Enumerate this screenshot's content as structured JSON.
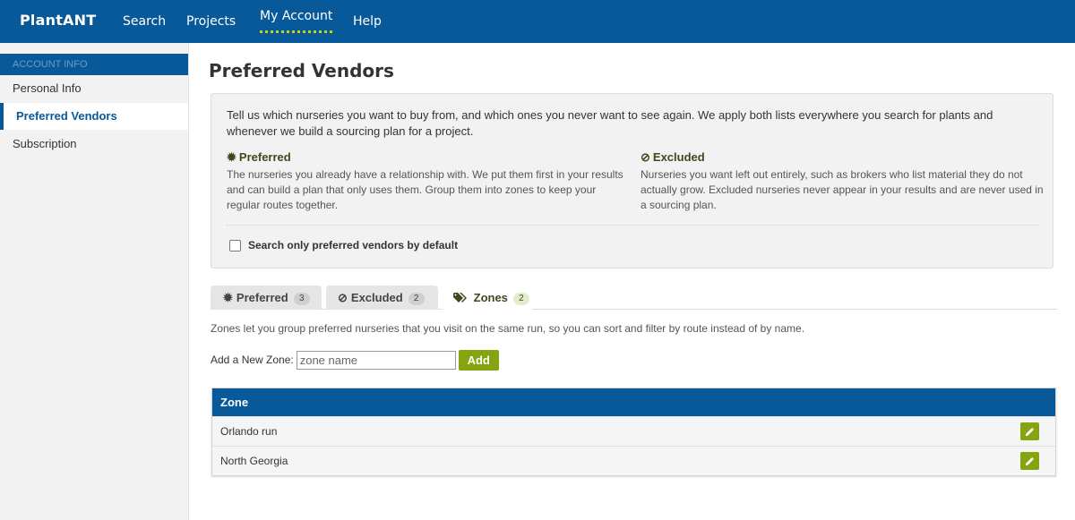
{
  "app": {
    "brand": "PlantANT",
    "nav": [
      {
        "label": "Search"
      },
      {
        "label": "Projects"
      },
      {
        "label": "My Account"
      },
      {
        "label": "Help"
      }
    ],
    "active_nav": "My Account"
  },
  "sidebar": {
    "heading": "ACCOUNT INFO",
    "items": [
      {
        "label": "Personal Info"
      },
      {
        "label": "Preferred Vendors"
      },
      {
        "label": "Subscription"
      }
    ],
    "active_item": "Preferred Vendors"
  },
  "page": {
    "title": "Preferred Vendors",
    "intro": "Tell us which nurseries you want to buy from, and which ones you never want to see again. We apply both lists everywhere you search for plants and whenever we build a sourcing plan for a project.",
    "preferred": {
      "title": "Preferred",
      "icon": "badge-icon",
      "text": "The nurseries you already have a relationship with. We put them first in your results and can build a plan that only uses them. Group them into zones to keep your regular routes together."
    },
    "excluded": {
      "title": "Excluded",
      "icon": "ban-icon",
      "text": "Nurseries you want left out entirely, such as brokers who list material they do not actually grow. Excluded nurseries never appear in your results and are never used in a sourcing plan."
    },
    "checkbox_label": "Search only preferred vendors by default",
    "checkbox_checked": false
  },
  "tabs": [
    {
      "label": "Preferred",
      "count": "3",
      "icon": "badge-icon"
    },
    {
      "label": "Excluded",
      "count": "2",
      "icon": "ban-icon"
    },
    {
      "label": "Zones",
      "count": "2",
      "icon": "tags-icon"
    }
  ],
  "active_tab": "Zones",
  "zones": {
    "description": "Zones let you group preferred nurseries that you visit on the same run, so you can sort and filter by route instead of by name.",
    "add_label": "Add a New Zone:",
    "input_placeholder": "zone name",
    "input_value": "",
    "add_button": "Add",
    "column_header": "Zone",
    "rows": [
      {
        "name": "Orlando run"
      },
      {
        "name": "North Georgia"
      }
    ]
  },
  "colors": {
    "brand_blue": "#075999",
    "accent_green": "#86a40f",
    "nav_underline": "#c7d21a",
    "heading_green": "#3b4a1d"
  }
}
